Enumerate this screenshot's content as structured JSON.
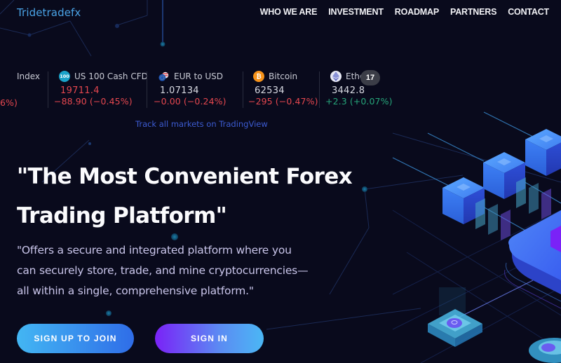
{
  "header": {
    "logo": "Tridetradefx",
    "nav": [
      {
        "label": "WHO WE ARE"
      },
      {
        "label": "INVESTMENT"
      },
      {
        "label": "ROADMAP"
      },
      {
        "label": "PARTNERS"
      },
      {
        "label": "CONTACT"
      }
    ]
  },
  "ticker": {
    "items": [
      {
        "name": "Index",
        "icon": "none",
        "price": "",
        "change": "6%)",
        "direction": "down"
      },
      {
        "name": "US 100 Cash CFD",
        "icon": "us100-icon",
        "icon_text": "100",
        "price": "19711.4",
        "change": "−88.90 (−0.45%)",
        "direction": "down"
      },
      {
        "name": "EUR to USD",
        "icon": "eur-usd-flags-icon",
        "price": "1.07134",
        "change": "−0.00 (−0.24%)",
        "direction": "down"
      },
      {
        "name": "Bitcoin",
        "icon": "bitcoin-icon",
        "icon_text": "₿",
        "price": "62534",
        "change": "−295 (−0.47%)",
        "direction": "down"
      },
      {
        "name": "Ethe…n",
        "icon": "ethereum-icon",
        "price": "3442.8",
        "change": "+2.3 (+0.07%)",
        "direction": "up"
      }
    ],
    "tv_badge": "17",
    "track_link": "Track all markets on TradingView"
  },
  "hero": {
    "title_line1": "\"The Most Convenient Forex",
    "title_line2": "Trading Platform\"",
    "subtitle_line1": "\"Offers a secure and integrated platform where you",
    "subtitle_line2": "can securely store, trade, and mine cryptocurrencies—",
    "subtitle_line3": "all within a single, comprehensive platform.\"",
    "signup_label": "SIGN UP TO JOIN",
    "signin_label": "SIGN IN"
  },
  "colors": {
    "background": "#090a1c",
    "logo": "#4aa3e6",
    "negative": "#e5474f",
    "positive": "#26a67a",
    "link": "#3c5bd1",
    "signup_gradient": [
      "#43b6f3",
      "#2f6de8"
    ],
    "signin_gradient": [
      "#7a22f7",
      "#4bb7f4"
    ]
  }
}
